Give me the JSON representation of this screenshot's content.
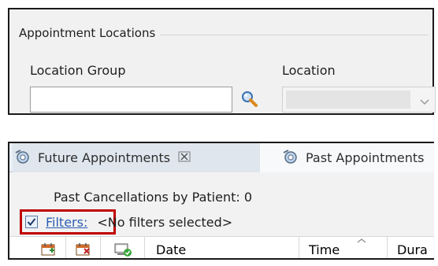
{
  "locations_panel": {
    "title": "Appointment Locations",
    "location_group_label": "Location Group",
    "location_group_value": "",
    "search_icon": "magnifier-icon",
    "location_label": "Location",
    "location_value": ""
  },
  "appointments_panel": {
    "tabs": [
      {
        "label": "Future Appointments",
        "icon": "appointments-icon",
        "closable": true,
        "active": true
      },
      {
        "label": "Past Appointments",
        "icon": "appointments-icon",
        "closable": false,
        "active": false
      }
    ],
    "cancellations_text": "Past Cancellations by Patient: 0",
    "filters": {
      "checked": true,
      "link_label": "Filters:",
      "status_text": "<No filters selected>"
    },
    "grid_columns": [
      {
        "icon": "calendar-add-icon"
      },
      {
        "icon": "calendar-remove-icon"
      },
      {
        "icon": "monitor-check-icon"
      },
      {
        "label": "Date"
      },
      {
        "label": "Time"
      },
      {
        "label": "Dura"
      }
    ]
  },
  "colors": {
    "highlight_border": "#c00000",
    "link": "#2a5db0"
  }
}
